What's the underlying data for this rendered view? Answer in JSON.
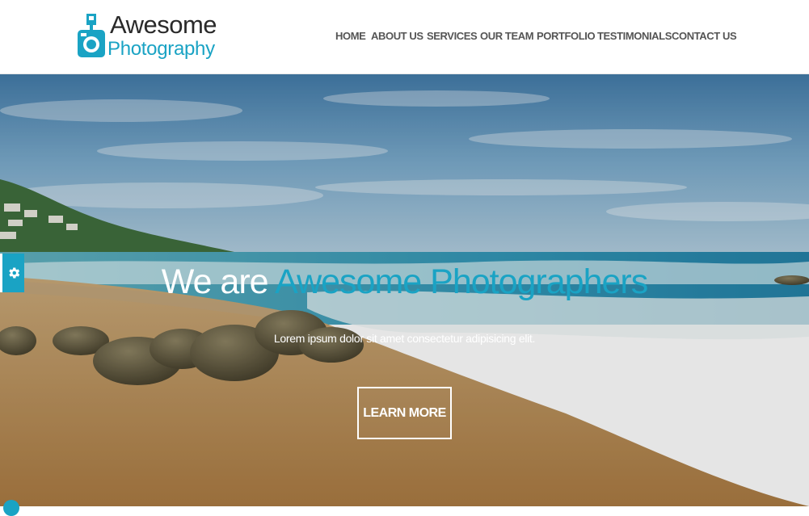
{
  "brand": {
    "line1": "Awesome",
    "line2": "Photography",
    "accent_color": "#1aa3c4",
    "icon": "camera-icon"
  },
  "nav": {
    "items": [
      {
        "label": "HOME"
      },
      {
        "label": "ABOUT US"
      },
      {
        "label": "SERVICES"
      },
      {
        "label": "OUR TEAM"
      },
      {
        "label": "PORTFOLIO"
      },
      {
        "label": "TESTIMONIALS"
      },
      {
        "label": "CONTACT US"
      }
    ]
  },
  "hero": {
    "title_prefix": "We are",
    "title_accent": "Awesome Photographers",
    "subtitle": "Lorem ipsum dolor sit amet consectetur adipisicing elit.",
    "cta_label": "LEARN MORE"
  },
  "settings": {
    "icon": "gear-icon"
  }
}
